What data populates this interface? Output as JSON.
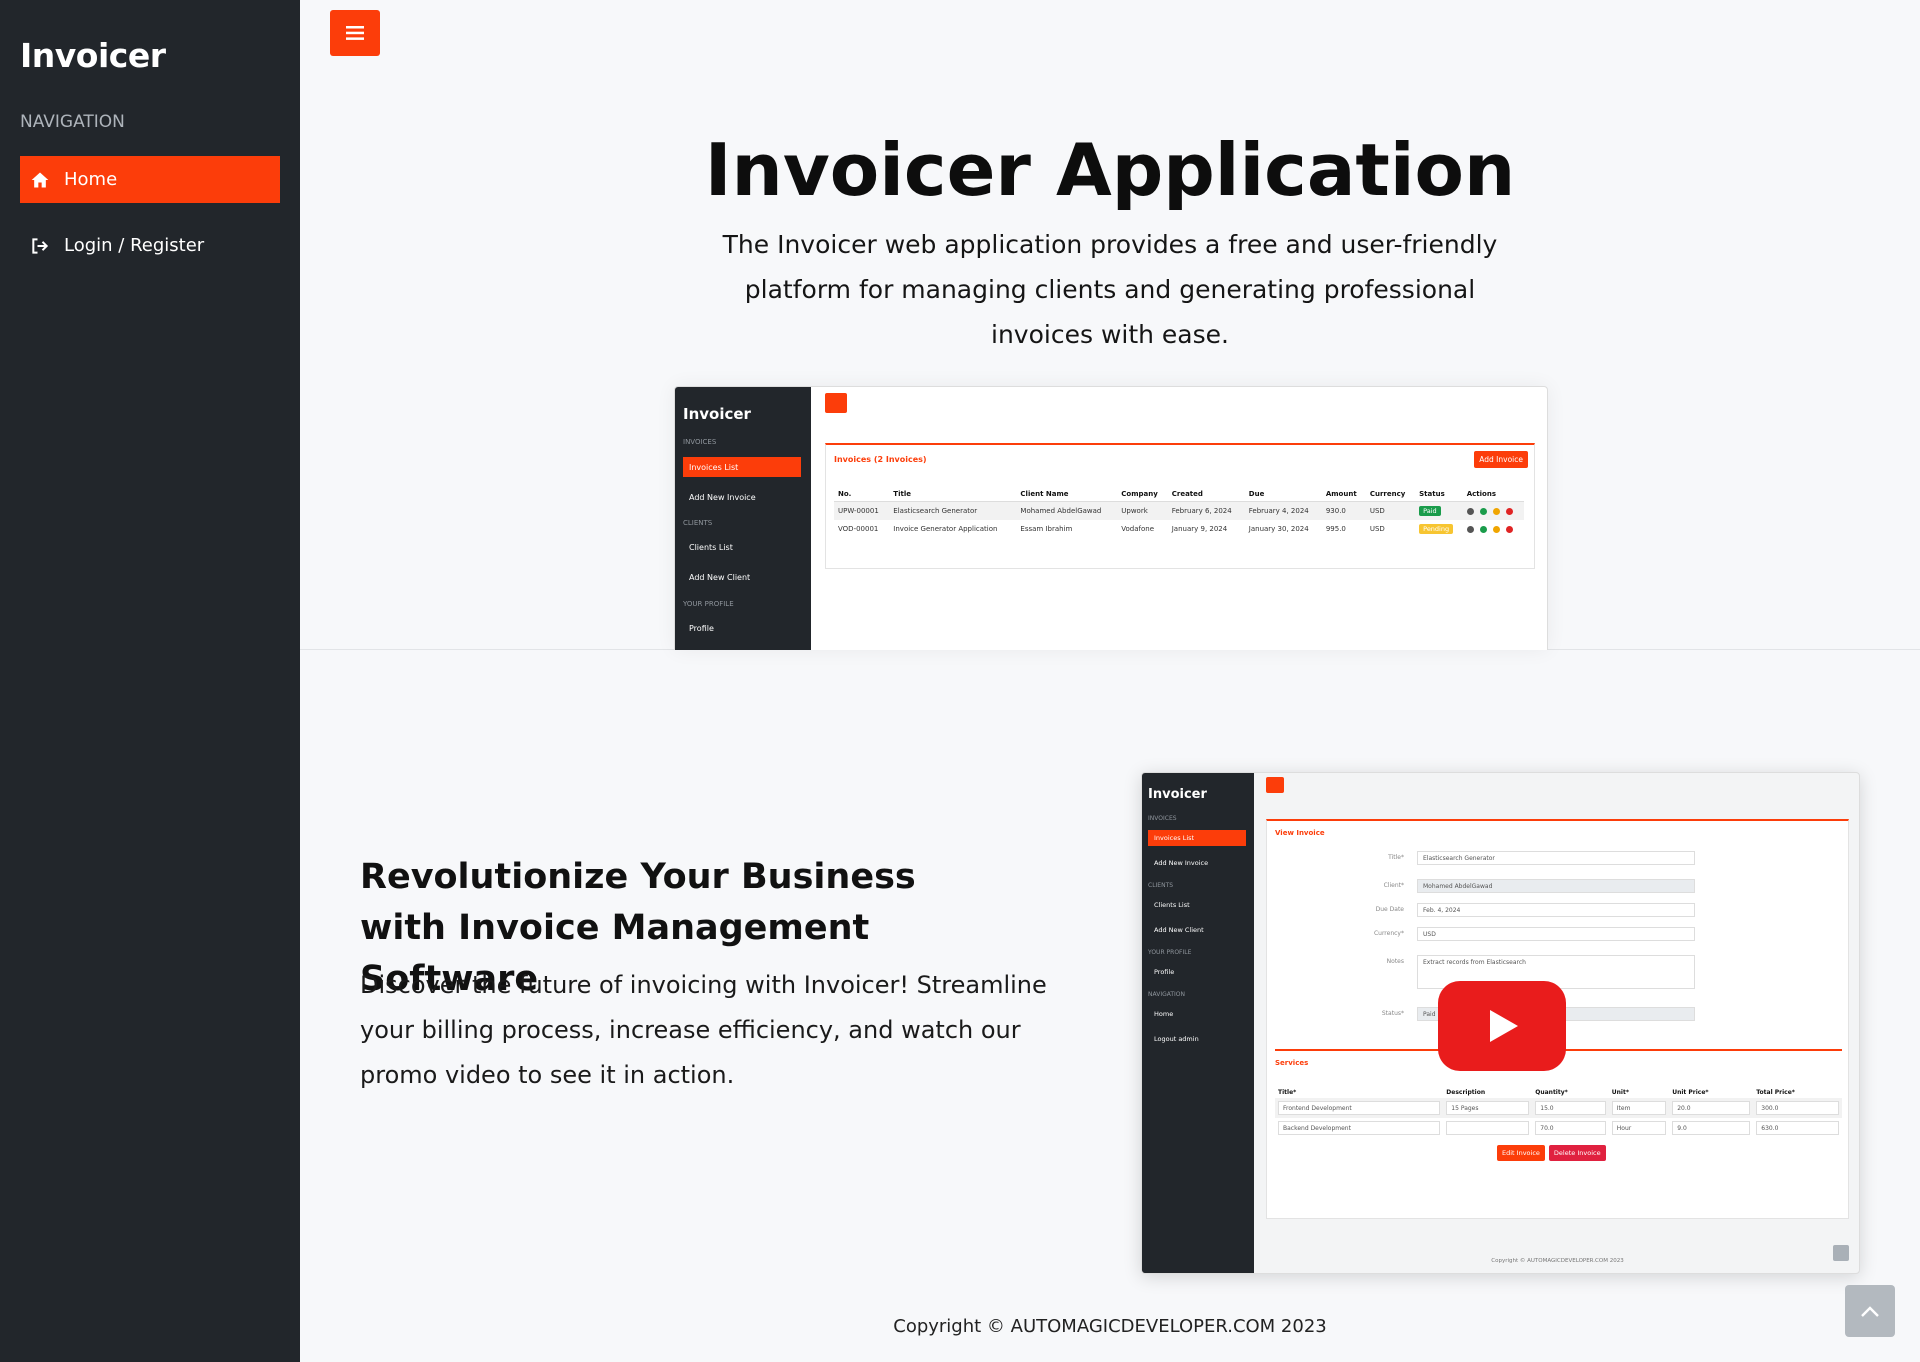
{
  "sidebar": {
    "logo": "Invoicer",
    "heading": "NAVIGATION",
    "items": [
      {
        "label": "Home",
        "icon": "home-icon",
        "active": true
      },
      {
        "label": "Login / Register",
        "icon": "login-icon",
        "active": false
      }
    ]
  },
  "hero": {
    "title": "Invoicer Application",
    "description": "The Invoicer web application provides a free and user-friendly platform for managing clients and generating professional invoices with ease."
  },
  "preview_list": {
    "logo": "Invoicer",
    "nav": {
      "h_invoices": "INVOICES",
      "invoices_list": "Invoices List",
      "add_invoice": "Add New Invoice",
      "h_clients": "CLIENTS",
      "clients_list": "Clients List",
      "add_client": "Add New Client",
      "h_profile": "YOUR PROFILE",
      "profile": "Profile"
    },
    "card_title": "Invoices (2 Invoices)",
    "add_button": "Add Invoice",
    "columns": [
      "No.",
      "Title",
      "Client Name",
      "Company",
      "Created",
      "Due",
      "Amount",
      "Currency",
      "Status",
      "Actions"
    ],
    "rows": [
      {
        "no": "UPW-00001",
        "title": "Elasticsearch Generator",
        "client": "Mohamed AbdelGawad",
        "company": "Upwork",
        "created": "February 6, 2024",
        "due": "February 4, 2024",
        "amount": "930.0",
        "currency": "USD",
        "status": "Paid"
      },
      {
        "no": "VOD-00001",
        "title": "Invoice Generator Application",
        "client": "Essam Ibrahim",
        "company": "Vodafone",
        "created": "January 9, 2024",
        "due": "January 30, 2024",
        "amount": "995.0",
        "currency": "USD",
        "status": "Pending"
      }
    ]
  },
  "section2": {
    "title": "Revolutionize Your Business with Invoice Management Software",
    "description": "Discover the future of invoicing with Invoicer! Streamline your billing process, increase efficiency, and watch our promo video to see it in action."
  },
  "preview_view": {
    "logo": "Invoicer",
    "nav": {
      "h_invoices": "INVOICES",
      "invoices_list": "Invoices List",
      "add_invoice": "Add New Invoice",
      "h_clients": "CLIENTS",
      "clients_list": "Clients List",
      "add_client": "Add New Client",
      "h_profile": "YOUR PROFILE",
      "profile": "Profile",
      "h_navigation": "NAVIGATION",
      "home": "Home",
      "logout": "Logout admin"
    },
    "card_title": "View Invoice",
    "fields": {
      "title_label": "Title*",
      "title_value": "Elasticsearch Generator",
      "client_label": "Client*",
      "client_value": "Mohamed AbdelGawad",
      "due_label": "Due Date",
      "due_value": "Feb. 4, 2024",
      "currency_label": "Currency*",
      "currency_value": "USD",
      "notes_label": "Notes",
      "notes_value": "Extract records from Elasticsearch",
      "status_label": "Status*",
      "status_value": "Paid"
    },
    "services_title": "Services",
    "service_columns": [
      "Title*",
      "Description",
      "Quantity*",
      "Unit*",
      "Unit Price*",
      "Total Price*"
    ],
    "services": [
      {
        "title": "Frontend Development",
        "description": "15 Pages",
        "quantity": "15.0",
        "unit": "Item",
        "unit_price": "20.0",
        "total": "300.0"
      },
      {
        "title": "Backend Development",
        "description": "",
        "quantity": "70.0",
        "unit": "Hour",
        "unit_price": "9.0",
        "total": "630.0"
      }
    ],
    "edit_button": "Edit Invoice",
    "delete_button": "Delete Invoice",
    "copyright": "Copyright © AUTOMAGICDEVELOPER.COM 2023"
  },
  "footer": {
    "copyright": "Copyright © AUTOMAGICDEVELOPER.COM 2023"
  },
  "colors": {
    "accent": "#fc3d0a",
    "sidebar": "#22262b",
    "play": "#e91c1c"
  }
}
